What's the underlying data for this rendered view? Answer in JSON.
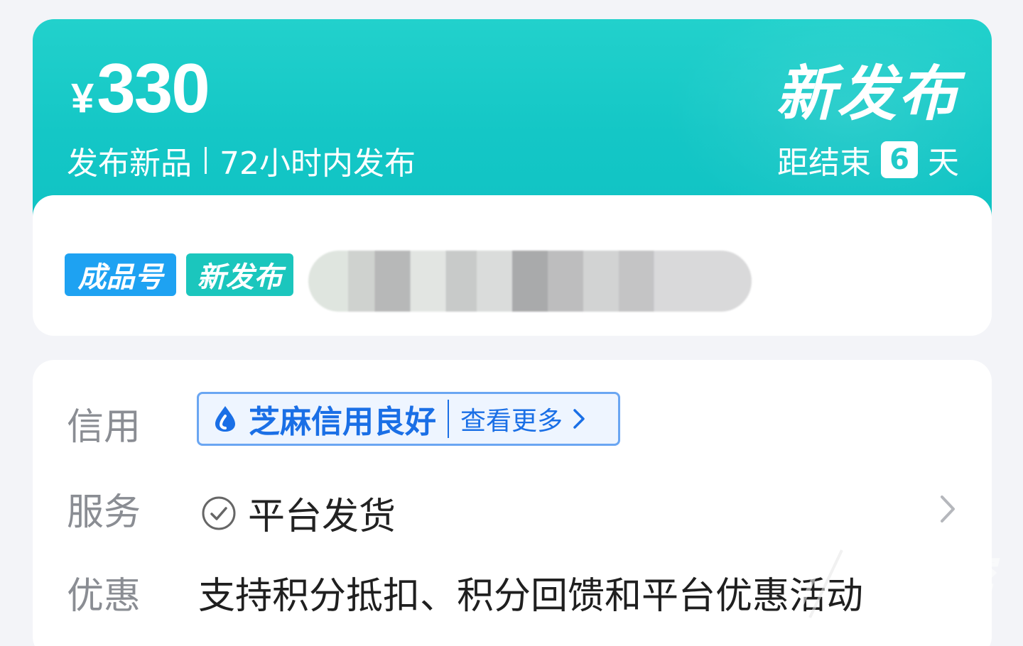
{
  "banner": {
    "currency": "¥",
    "price": "330",
    "subtitle_left": "发布新品",
    "subtitle_right": "72小时内发布",
    "status_title": "新发布",
    "countdown_prefix": "距结束",
    "countdown_days": "6",
    "countdown_suffix": "天"
  },
  "listing": {
    "tags": [
      "成品号",
      "新发布"
    ],
    "title_blurred": true
  },
  "info": {
    "credit_label": "信用",
    "credit_status": "芝麻信用良好",
    "credit_more": "查看更多",
    "service_label": "服务",
    "service_value": "平台发货",
    "discount_label": "优惠",
    "discount_value": "支持积分抵扣、积分回馈和平台优惠活动"
  },
  "watermark": {
    "text": "九游"
  },
  "colors": {
    "banner": "#14c7c6",
    "tag_finished": "#1ea2f2",
    "tag_new": "#1bc6bd",
    "credit_blue": "#1a6fe6"
  }
}
